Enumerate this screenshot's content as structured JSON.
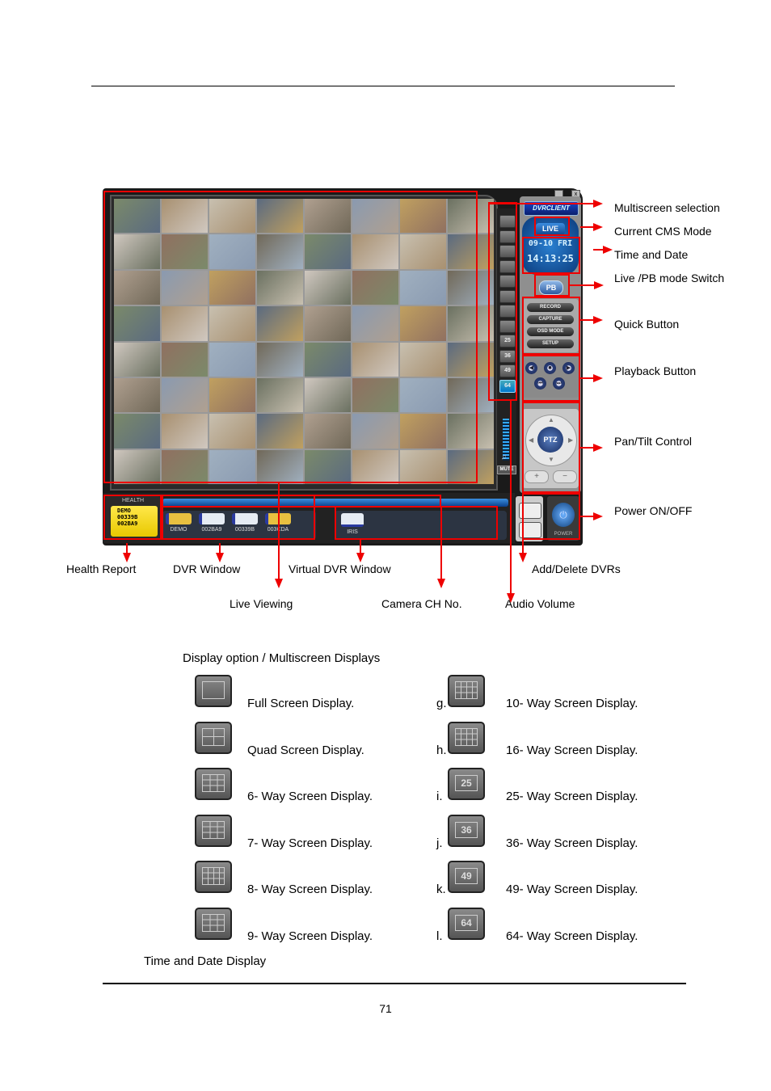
{
  "page": {
    "number": "71"
  },
  "app": {
    "titlebar": {
      "minimize": "_",
      "close": "x"
    },
    "brand": "DVRCLIENT",
    "mode": "LIVE",
    "date": "09-10  FRI",
    "time": "14:13:25",
    "pb_switch": "PB",
    "quick_buttons": [
      "RECORD",
      "CAPTURE",
      "OSD MODE",
      "SETUP"
    ],
    "playback_buttons": [
      {
        "icon": "rewind-icon",
        "glyph": "◀"
      },
      {
        "icon": "stop-icon",
        "glyph": "■"
      },
      {
        "icon": "play-icon",
        "glyph": "▶"
      },
      {
        "icon": "previous-icon",
        "glyph": "⏮"
      },
      {
        "icon": "next-icon",
        "glyph": "⏭"
      }
    ],
    "ptz_label": "PTZ",
    "zoom_in": "+",
    "zoom_out": "−",
    "multiscreen_modes": [
      "1",
      "4",
      "6",
      "7",
      "8",
      "9",
      "10",
      "16",
      "25",
      "36",
      "49",
      "64"
    ],
    "multiscreen_labels": [
      "",
      "",
      "",
      "",
      "",
      "",
      "",
      "",
      "25",
      "36",
      "49",
      "64"
    ],
    "active_mode": "64",
    "mute_label": "MUTE",
    "audio_volume": 0.75,
    "camera_count": 64,
    "health": {
      "title": "HEALTH",
      "lines": [
        "DEMO",
        "00339B",
        "002BA9"
      ]
    },
    "dvrs": [
      {
        "name": "DEMO",
        "status": "unknown",
        "color": "#e8c040"
      },
      {
        "name": "002BA9",
        "status": "ok",
        "color": "#e6ecf4"
      },
      {
        "name": "00339B",
        "status": "ok",
        "color": "#e6ecf4"
      },
      {
        "name": "003CDA",
        "status": "warning",
        "color": "#e8c040"
      }
    ],
    "virtual_dvrs": [
      {
        "name": "IRIS"
      }
    ],
    "power_label": "POWER"
  },
  "callouts": {
    "right": [
      "Multiscreen selection",
      "Current CMS Mode",
      "Time and Date",
      "Live /PB mode Switch",
      "Quick Button",
      "Playback Button",
      "Pan/Tilt Control",
      "Power ON/OFF"
    ],
    "bottom_row1": [
      "Health Report",
      "DVR Window",
      "Virtual DVR Window",
      "Add/Delete DVRs"
    ],
    "bottom_row2": [
      "Live Viewing",
      "Camera CH No.",
      "Audio Volume"
    ]
  },
  "legend": {
    "heading": "Display option / Multiscreen Displays",
    "left": [
      {
        "letter": "",
        "label": "Full Screen Display."
      },
      {
        "letter": "",
        "label": "Quad Screen Display."
      },
      {
        "letter": "",
        "label": "6- Way Screen Display."
      },
      {
        "letter": "",
        "label": "7- Way Screen Display."
      },
      {
        "letter": "",
        "label": "8- Way Screen Display."
      },
      {
        "letter": "",
        "label": "9- Way Screen Display."
      }
    ],
    "right": [
      {
        "letter": "g.",
        "label": "10- Way Screen Display.",
        "num": ""
      },
      {
        "letter": "h.",
        "label": "16- Way Screen Display.",
        "num": ""
      },
      {
        "letter": "i.",
        "label": "25- Way Screen Display.",
        "num": "25"
      },
      {
        "letter": "j.",
        "label": "36- Way Screen Display.",
        "num": "36"
      },
      {
        "letter": "k.",
        "label": "49- Way Screen Display.",
        "num": "49"
      },
      {
        "letter": "l.",
        "label": "64- Way Screen Display.",
        "num": "64"
      }
    ],
    "footer": "Time and Date Display"
  },
  "colors": {
    "annotation": "#e00000",
    "accent_blue": "#1e6fd0",
    "health_yellow": "#f2d400"
  }
}
